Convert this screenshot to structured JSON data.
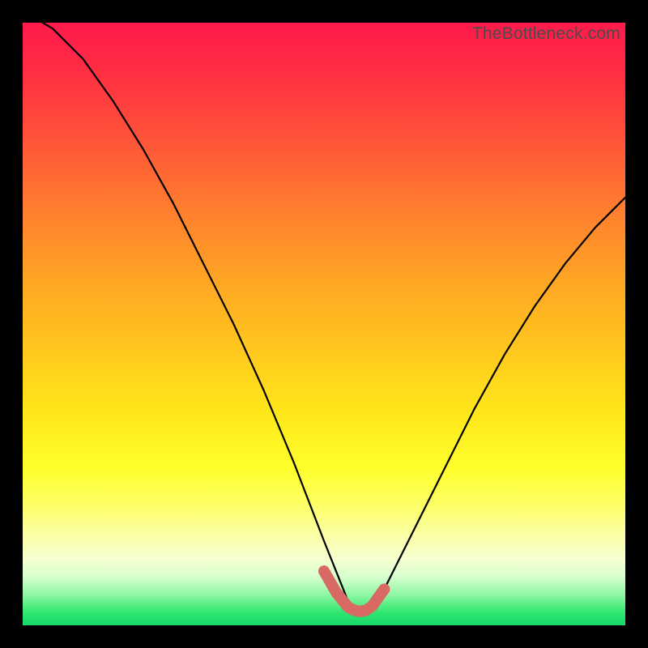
{
  "watermark": "TheBottleneck.com",
  "chart_data": {
    "type": "line",
    "title": "",
    "xlabel": "",
    "ylabel": "",
    "xlim": [
      0,
      100
    ],
    "ylim": [
      0,
      100
    ],
    "grid": false,
    "series": [
      {
        "name": "bottleneck-curve",
        "x": [
          0,
          5,
          10,
          15,
          20,
          25,
          30,
          35,
          40,
          45,
          50,
          52,
          54,
          55,
          56,
          57,
          58,
          60,
          62,
          65,
          70,
          75,
          80,
          85,
          90,
          95,
          100
        ],
        "values": [
          102,
          99,
          94,
          87,
          79,
          70,
          60,
          50,
          39,
          27,
          14,
          9,
          4,
          2.5,
          2,
          2.3,
          3.2,
          6,
          10,
          16,
          26,
          36,
          45,
          53,
          60,
          66,
          71
        ]
      }
    ],
    "highlight": {
      "name": "optimal-range",
      "color": "#d86a63",
      "x": [
        50,
        52,
        54,
        55,
        56,
        57,
        58,
        60
      ],
      "values": [
        9,
        5.5,
        3,
        2.5,
        2.3,
        2.5,
        3.2,
        6
      ]
    }
  },
  "colors": {
    "curve": "#000000",
    "highlight": "#d86a63",
    "watermark": "#4b4b4b"
  }
}
